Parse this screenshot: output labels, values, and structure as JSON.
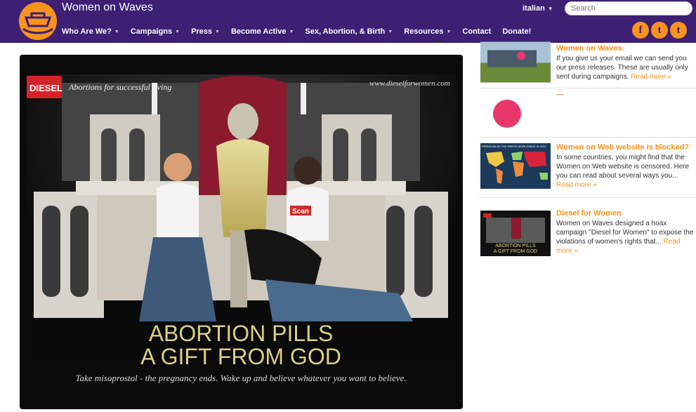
{
  "header": {
    "site_title": "Women on Waves",
    "language": "italian",
    "search_placeholder": "Search",
    "nav": [
      {
        "label": "Who Are We?",
        "dropdown": true
      },
      {
        "label": "Campaigns",
        "dropdown": true
      },
      {
        "label": "Press",
        "dropdown": true
      },
      {
        "label": "Become Active",
        "dropdown": true
      },
      {
        "label": "Sex, Abortion, & Birth",
        "dropdown": true
      },
      {
        "label": "Resources",
        "dropdown": true
      },
      {
        "label": "Contact",
        "dropdown": false
      },
      {
        "label": "Donate!",
        "dropdown": false
      }
    ],
    "social": [
      {
        "icon": "facebook-icon",
        "glyph": "f"
      },
      {
        "icon": "twitter-icon",
        "glyph": "t"
      },
      {
        "icon": "tumblr-icon",
        "glyph": "t"
      }
    ]
  },
  "hero": {
    "brand": "DIESEL",
    "tagline": "Abortions for successful living",
    "url": "www.dieselforwomen.com",
    "scan_label": "Scan",
    "headline_1": "ABORTION PILLS",
    "headline_2": "A GIFT FROM GOD",
    "caption": "Take misoprostol - the pregnancy ends. Wake up and believe whatever you want to believe."
  },
  "sidebar": {
    "items": [
      {
        "title": "Women on Waves.",
        "text": "If you give us your email we can send you our press releases. These are usually only sent during campaigns.",
        "more": "Read more »"
      },
      {
        "title": "—",
        "text": "",
        "more": ""
      },
      {
        "title": "Women on Web website is blocked?",
        "text": "In some countries, you might find that the Women on Web website is censored. Here you can read about several ways you...",
        "more": "Read more »"
      },
      {
        "title": "Diesel for Women",
        "text": "Women on Waves designed a hoax campaign \"Diesel for Women\" to expose the violations of women's rights that...",
        "more": "Read more »"
      }
    ],
    "map_caption": "FREEDOM OF THE PRESS WORLDWIDE IN 2011",
    "thumb_headline_1": "ABORTION PILLS",
    "thumb_headline_2": "A GIFT FROM GOD"
  },
  "colors": {
    "header_bg": "#3d1f73",
    "accent": "#f7931e",
    "pink_dot": "#e8386b"
  }
}
